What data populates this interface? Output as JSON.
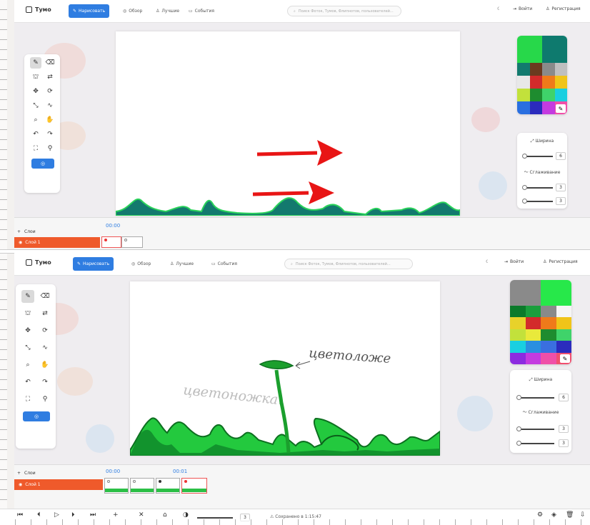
{
  "top": {
    "logo": "Тумо",
    "nav": {
      "draw": "Нарисовать",
      "overview": "Обзор",
      "best": "Лучшие",
      "events": "События",
      "search_placeholder": "Поиск Фоток, Тумов, Флипнотов, пользователей...",
      "login": "Войти",
      "register": "Регистрация"
    },
    "toolbar_icons": [
      "pencil-icon",
      "eraser-icon",
      "bucket-icon",
      "swap-icon",
      "move-icon",
      "rotate-icon",
      "scale-icon",
      "wave-icon",
      "zoom-icon",
      "hand-icon",
      "undo-icon",
      "redo-icon",
      "fullscreen-icon",
      "eyedropper-icon"
    ],
    "palette": {
      "primary": "#27d84a",
      "secondary": "#0e7a6e",
      "colors": [
        "#127a6e",
        "#6b3a1f",
        "#8a8a8a",
        "#bfbfbf",
        "#e8e8e8",
        "#d32b2b",
        "#ef7a1a",
        "#f0c419",
        "#c2e13b",
        "#1e8c2f",
        "#3fd36a",
        "#19cfe0",
        "#2a6fe0",
        "#2b2bbd",
        "#c43be0",
        "#f04fa8"
      ]
    },
    "brush": {
      "width_label": "Ширина",
      "width_value": "6",
      "smoothing_label": "Сглаживание",
      "smooth_a": "3",
      "smooth_b": "3"
    },
    "timeline": {
      "layers_label": "Слои",
      "time": "00:00",
      "layer_name": "Слой 1"
    }
  },
  "bottom": {
    "logo": "Тумо",
    "nav": {
      "draw": "Нарисовать",
      "overview": "Обзор",
      "best": "Лучшие",
      "events": "События",
      "search_placeholder": "Поиск Фоток, Тумов, Флипнотов, пользователей...",
      "login": "Войти",
      "register": "Регистрация"
    },
    "toolbar_icons": [
      "pencil-icon",
      "eraser-icon",
      "bucket-icon",
      "swap-icon",
      "move-icon",
      "rotate-icon",
      "scale-icon",
      "wave-icon",
      "zoom-icon",
      "hand-icon",
      "undo-icon",
      "redo-icon",
      "fullscreen-icon",
      "eyedropper-icon"
    ],
    "palette": {
      "primary": "#8a8a8a",
      "secondary": "#27e84a",
      "colors": [
        "#0b7a2a",
        "#1b9f3d",
        "#8a8a8a",
        "#f5f5f5",
        "#e8d22a",
        "#d32b2b",
        "#ef7a1a",
        "#f0c419",
        "#c2e13b",
        "#e9e93b",
        "#1e8c2f",
        "#3fd36a",
        "#19cfe0",
        "#2a8fe0",
        "#3a6fe0",
        "#2b2bbd",
        "#8c2be0",
        "#c43be0",
        "#f04fa8",
        "#f04f6f"
      ]
    },
    "brush": {
      "width_label": "Ширина",
      "width_value": "6",
      "smoothing_label": "Сглаживание",
      "smooth_a": "3",
      "smooth_b": "3"
    },
    "timeline": {
      "layers_label": "Слои",
      "time_a": "00:00",
      "time_b": "00:01",
      "layer_name": "Слой 1"
    },
    "canvas_text": {
      "label_grey": "цветоножка",
      "label_dark": "цветоложе"
    },
    "controls": {
      "zoom": "3",
      "status": "Сохранено в 1:15:47"
    }
  }
}
